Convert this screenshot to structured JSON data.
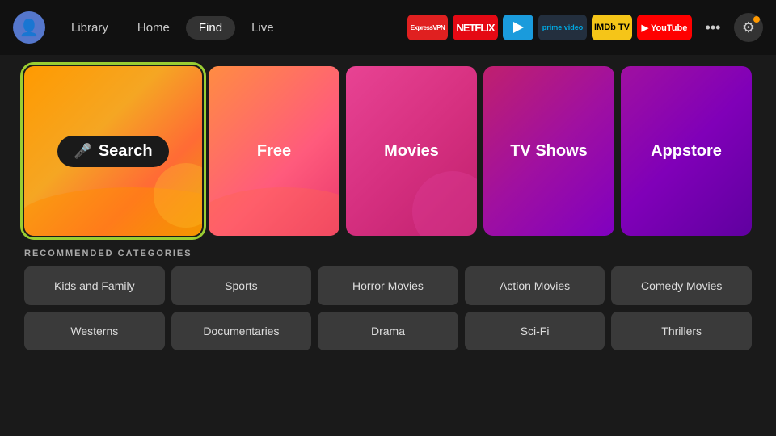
{
  "nav": {
    "avatar_icon": "👤",
    "links": [
      {
        "label": "Library",
        "active": false
      },
      {
        "label": "Home",
        "active": false
      },
      {
        "label": "Find",
        "active": true
      },
      {
        "label": "Live",
        "active": false
      }
    ],
    "apps": [
      {
        "id": "expressvpn",
        "label": "ExpressVPN"
      },
      {
        "id": "netflix",
        "label": "NETFLIX"
      },
      {
        "id": "freevee",
        "label": "⮞"
      },
      {
        "id": "prime",
        "label": "prime video"
      },
      {
        "id": "imdb",
        "label": "IMDb TV"
      },
      {
        "id": "youtube",
        "label": "▶ YouTube"
      }
    ],
    "more_label": "•••",
    "settings_label": "⚙"
  },
  "tiles": [
    {
      "id": "search",
      "label": "Search",
      "mic": "🎤"
    },
    {
      "id": "free",
      "label": "Free"
    },
    {
      "id": "movies",
      "label": "Movies"
    },
    {
      "id": "tvshows",
      "label": "TV Shows"
    },
    {
      "id": "appstore",
      "label": "Appstore"
    }
  ],
  "recommended": {
    "title": "RECOMMENDED CATEGORIES",
    "rows": [
      [
        "Kids and Family",
        "Sports",
        "Horror Movies",
        "Action Movies",
        "Comedy Movies"
      ],
      [
        "Westerns",
        "Documentaries",
        "Drama",
        "Sci-Fi",
        "Thrillers"
      ]
    ]
  }
}
